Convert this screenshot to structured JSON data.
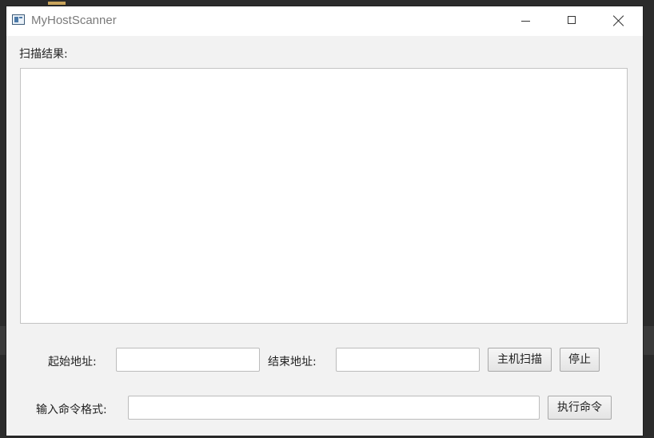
{
  "window": {
    "title": "MyHostScanner"
  },
  "results": {
    "label": "扫描结果:",
    "content": ""
  },
  "scan": {
    "start_label": "起始地址:",
    "start_value": "",
    "end_label": "结束地址:",
    "end_value": "",
    "scan_button": "主机扫描",
    "stop_button": "停止"
  },
  "command": {
    "label": "输入命令格式:",
    "value": "",
    "execute_button": "执行命令"
  },
  "icons": {
    "app": "window-app-icon",
    "minimize": "minimize-icon",
    "maximize": "maximize-icon",
    "close": "close-icon"
  }
}
